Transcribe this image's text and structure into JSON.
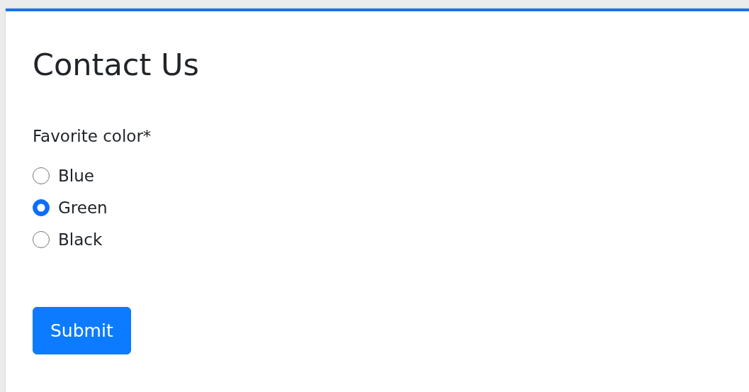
{
  "title": "Contact Us",
  "field": {
    "label": "Favorite color*",
    "options": [
      {
        "label": "Blue",
        "selected": false
      },
      {
        "label": "Green",
        "selected": true
      },
      {
        "label": "Black",
        "selected": false
      }
    ]
  },
  "buttons": [
    {
      "label": "Submit"
    }
  ]
}
